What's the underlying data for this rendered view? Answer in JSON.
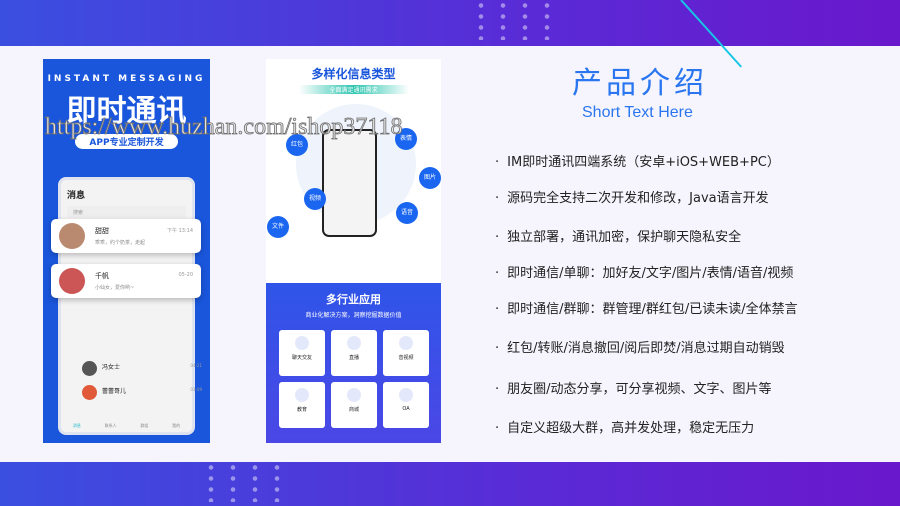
{
  "left_panel": {
    "en": "INSTANT MESSAGING",
    "title": "即时通讯",
    "pill": "APP专业定制开发",
    "phone": {
      "header": "消息",
      "search": "搜索",
      "chats": [
        {
          "name": "甜甜",
          "msg": "乖乖，约个奶茶，走起",
          "time": "下午 13:14"
        },
        {
          "name": "千帆",
          "msg": "小仙女，爱你哟~",
          "time": "05-20"
        }
      ],
      "rows": [
        {
          "name": "冯女士",
          "time": "04-21"
        },
        {
          "name": "蕾蕾哥儿",
          "time": "03-09"
        }
      ],
      "tabs": [
        "消息",
        "联系人",
        "群组",
        "我的"
      ]
    }
  },
  "mid_panel": {
    "title": "多样化信息类型",
    "sub": "全面满足通讯需求",
    "bubbles": [
      "红包",
      "表情",
      "图片",
      "视频",
      "语音",
      "文件"
    ],
    "industry_title": "多行业应用",
    "industry_sub": "商业化解决方案，洞察挖掘数据价值",
    "cards": [
      "聊天交友",
      "直播",
      "音视频",
      "教育",
      "商城",
      "OA"
    ]
  },
  "main": {
    "title": "产品介绍",
    "subtitle": "Short Text Here",
    "bullet": "·",
    "features": [
      "IM即时通讯四端系统（安卓+iOS+WEB+PC）",
      "源码完全支持二次开发和修改，Java语言开发",
      "独立部署，通讯加密，保护聊天隐私安全",
      "即时通信/单聊：加好友/文字/图片/表情/语音/视频",
      "即时通信/群聊：群管理/群红包/已读未读/全体禁言",
      "红包/转账/消息撤回/阅后即焚/消息过期自动销毁",
      "朋友圈/动态分享，可分享视频、文字、图片等",
      "自定义超级大群，高并发处理，稳定无压力"
    ]
  },
  "watermark": "https://www.huzhan.com/ishop37118",
  "colors": {
    "accent": "#2a76f0",
    "panel_blue": "#1a56db"
  }
}
